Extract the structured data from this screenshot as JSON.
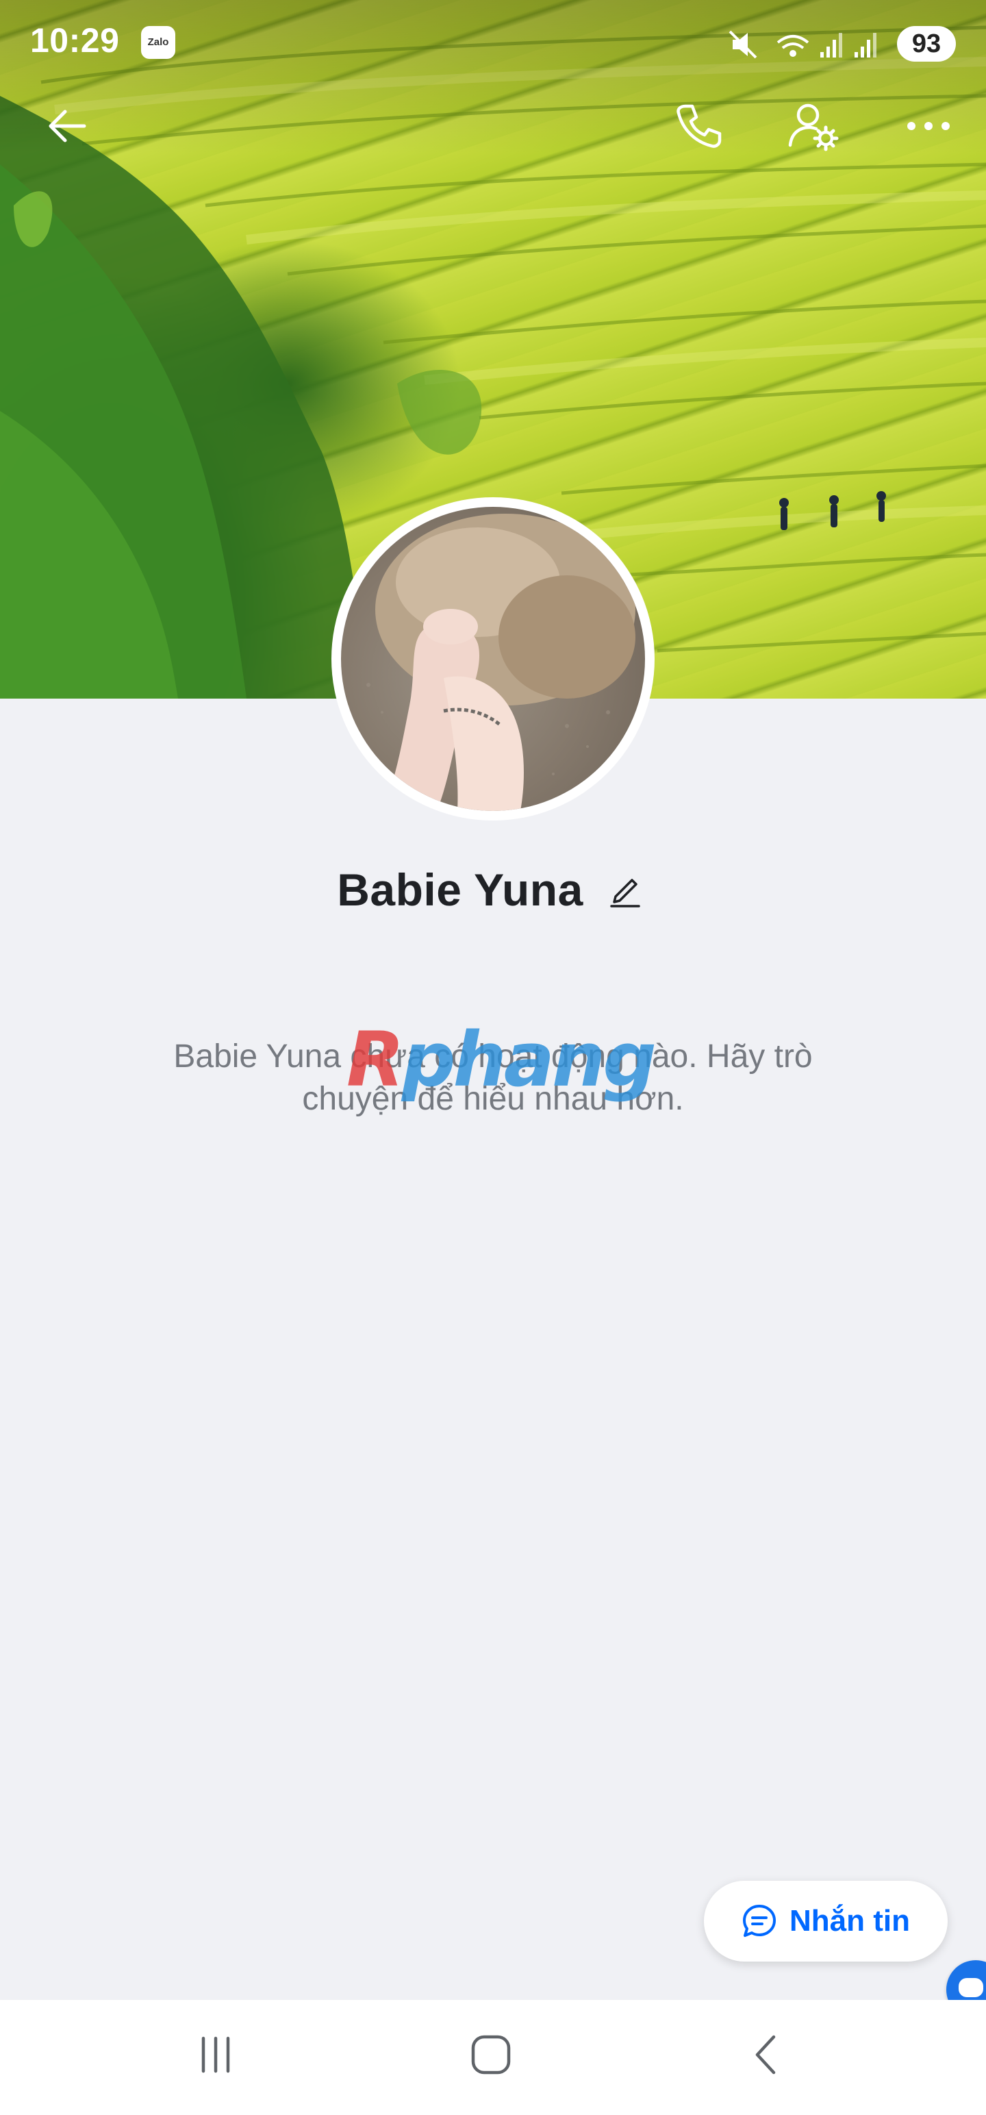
{
  "status_bar": {
    "time": "10:29",
    "notification_app": "Zalo",
    "battery_level": "93",
    "icons": [
      "mute-icon",
      "wifi-icon",
      "signal-icon",
      "signal-icon"
    ]
  },
  "top_bar": {
    "back_icon": "arrow-left-icon",
    "call_icon": "phone-icon",
    "settings_icon": "user-settings-icon",
    "more_icon": "more-horizontal-icon"
  },
  "profile": {
    "name": "Babie Yuna",
    "edit_icon": "pencil-icon"
  },
  "empty_state": {
    "line1": "Babie Yuna chưa có hoạt động nào. Hãy trò",
    "line2": "chuyện để hiểu nhau hơn."
  },
  "watermark": {
    "first_letter": "R",
    "rest": "phang"
  },
  "actions": {
    "message_label": "Nhắn tin",
    "message_icon": "chat-bubble-icon"
  },
  "nav_bar": {
    "recents_icon": "recents-icon",
    "home_icon": "home-icon",
    "back_icon": "nav-back-icon"
  },
  "colors": {
    "accent": "#0068ff",
    "background": "#f0f1f5",
    "text_primary": "#1f2125",
    "text_secondary": "#757980"
  }
}
